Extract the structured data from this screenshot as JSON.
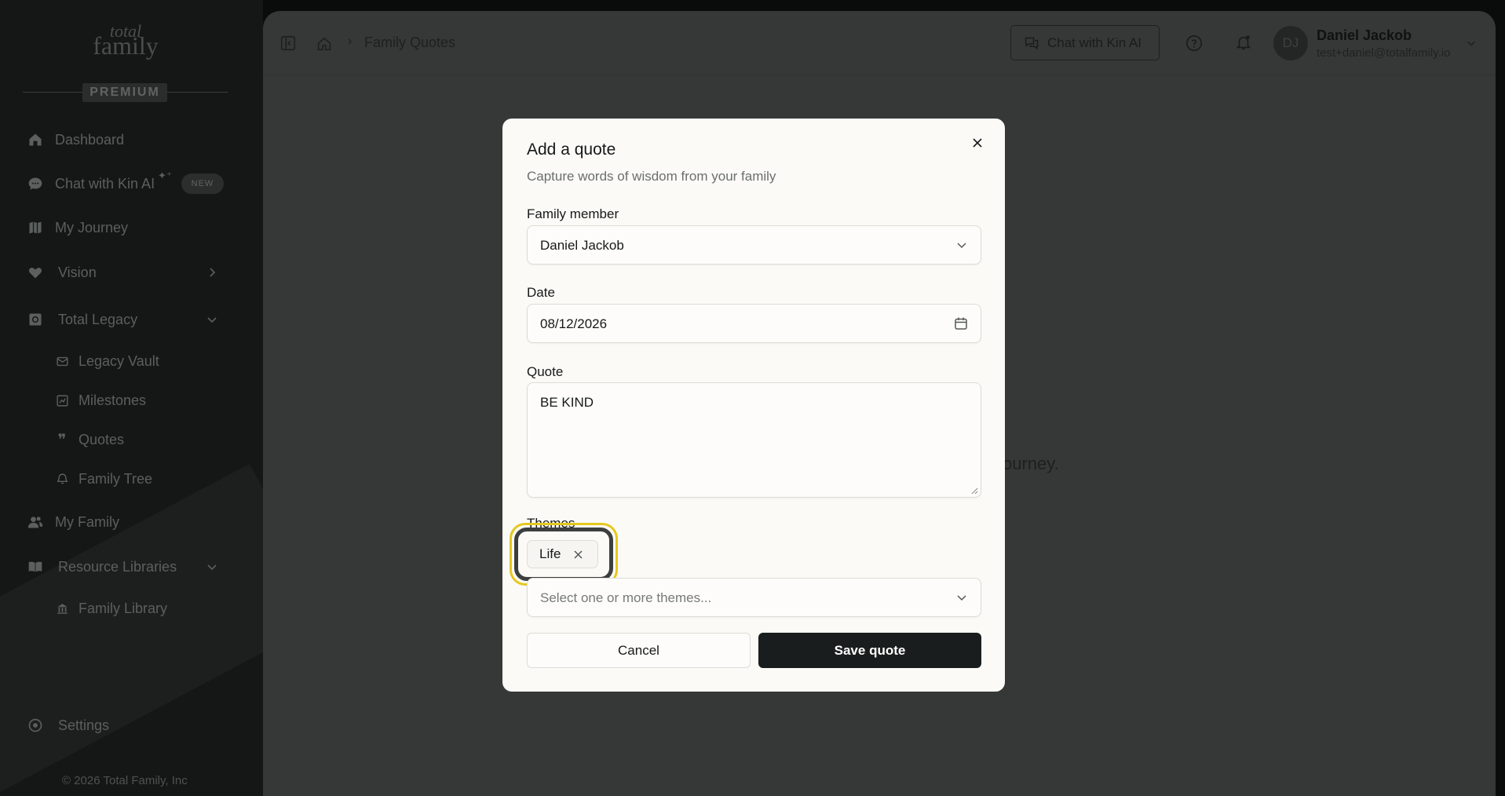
{
  "sidebar": {
    "logo_line1": "total",
    "logo_line2": "family",
    "premium": "PREMIUM",
    "items": [
      {
        "label": "Dashboard"
      },
      {
        "label": "Chat with Kin AI",
        "badge": "NEW"
      },
      {
        "label": "My Journey"
      },
      {
        "label": "Vision"
      },
      {
        "label": "Total Legacy"
      },
      {
        "label": "Legacy Vault"
      },
      {
        "label": "Milestones"
      },
      {
        "label": "Quotes"
      },
      {
        "label": "Family Tree"
      },
      {
        "label": "My Family"
      },
      {
        "label": "Resource Libraries"
      },
      {
        "label": "Family Library"
      },
      {
        "label": "Settings"
      }
    ],
    "copyright": "© 2026 Total Family, Inc"
  },
  "header": {
    "breadcrumb": "Family Quotes",
    "chat_button": "Chat with Kin AI",
    "user": {
      "initials": "DJ",
      "name": "Daniel Jackob",
      "email": "test+daniel@totalfamily.io"
    }
  },
  "background": {
    "partial_text": "s journey."
  },
  "modal": {
    "title": "Add a quote",
    "subtitle": "Capture words of wisdom from your family",
    "family_member_label": "Family member",
    "family_member_value": "Daniel Jackob",
    "date_label": "Date",
    "date_value": "08/12/2026",
    "quote_label": "Quote",
    "quote_value": "BE KIND",
    "themes_label": "Themes",
    "selected_themes": [
      "Life"
    ],
    "themes_placeholder": "Select one or more themes...",
    "cancel_label": "Cancel",
    "save_label": "Save quote"
  },
  "colors": {
    "save_button": "#1a1d1d",
    "highlight": "#e6c81e",
    "modal_bg": "#fbfaf6"
  },
  "icons": [
    "home-icon",
    "chat-icon",
    "map-icon",
    "heart-icon",
    "vault-icon",
    "mail-icon",
    "milestone-icon",
    "quote-icon",
    "tree-icon",
    "users-icon",
    "book-icon",
    "library-icon",
    "settings-icon",
    "sidebar-toggle-icon",
    "help-icon",
    "bell-icon",
    "close-icon",
    "calendar-icon",
    "chevron-down-icon"
  ]
}
